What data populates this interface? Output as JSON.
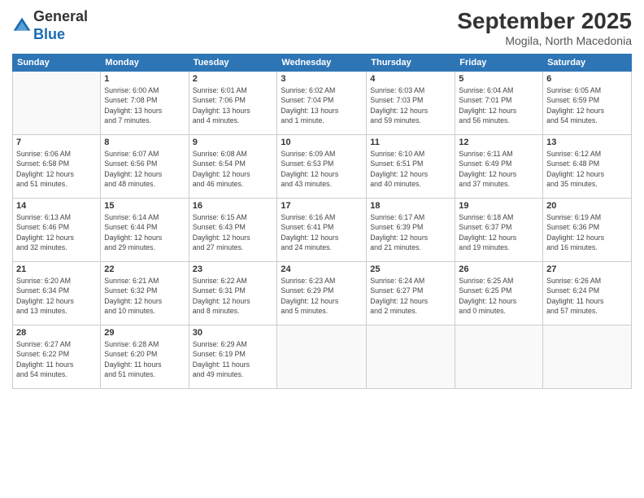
{
  "header": {
    "logo_line1": "General",
    "logo_line2": "Blue",
    "month": "September 2025",
    "location": "Mogila, North Macedonia"
  },
  "weekdays": [
    "Sunday",
    "Monday",
    "Tuesday",
    "Wednesday",
    "Thursday",
    "Friday",
    "Saturday"
  ],
  "weeks": [
    [
      {
        "day": "",
        "info": ""
      },
      {
        "day": "1",
        "info": "Sunrise: 6:00 AM\nSunset: 7:08 PM\nDaylight: 13 hours\nand 7 minutes."
      },
      {
        "day": "2",
        "info": "Sunrise: 6:01 AM\nSunset: 7:06 PM\nDaylight: 13 hours\nand 4 minutes."
      },
      {
        "day": "3",
        "info": "Sunrise: 6:02 AM\nSunset: 7:04 PM\nDaylight: 13 hours\nand 1 minute."
      },
      {
        "day": "4",
        "info": "Sunrise: 6:03 AM\nSunset: 7:03 PM\nDaylight: 12 hours\nand 59 minutes."
      },
      {
        "day": "5",
        "info": "Sunrise: 6:04 AM\nSunset: 7:01 PM\nDaylight: 12 hours\nand 56 minutes."
      },
      {
        "day": "6",
        "info": "Sunrise: 6:05 AM\nSunset: 6:59 PM\nDaylight: 12 hours\nand 54 minutes."
      }
    ],
    [
      {
        "day": "7",
        "info": "Sunrise: 6:06 AM\nSunset: 6:58 PM\nDaylight: 12 hours\nand 51 minutes."
      },
      {
        "day": "8",
        "info": "Sunrise: 6:07 AM\nSunset: 6:56 PM\nDaylight: 12 hours\nand 48 minutes."
      },
      {
        "day": "9",
        "info": "Sunrise: 6:08 AM\nSunset: 6:54 PM\nDaylight: 12 hours\nand 46 minutes."
      },
      {
        "day": "10",
        "info": "Sunrise: 6:09 AM\nSunset: 6:53 PM\nDaylight: 12 hours\nand 43 minutes."
      },
      {
        "day": "11",
        "info": "Sunrise: 6:10 AM\nSunset: 6:51 PM\nDaylight: 12 hours\nand 40 minutes."
      },
      {
        "day": "12",
        "info": "Sunrise: 6:11 AM\nSunset: 6:49 PM\nDaylight: 12 hours\nand 37 minutes."
      },
      {
        "day": "13",
        "info": "Sunrise: 6:12 AM\nSunset: 6:48 PM\nDaylight: 12 hours\nand 35 minutes."
      }
    ],
    [
      {
        "day": "14",
        "info": "Sunrise: 6:13 AM\nSunset: 6:46 PM\nDaylight: 12 hours\nand 32 minutes."
      },
      {
        "day": "15",
        "info": "Sunrise: 6:14 AM\nSunset: 6:44 PM\nDaylight: 12 hours\nand 29 minutes."
      },
      {
        "day": "16",
        "info": "Sunrise: 6:15 AM\nSunset: 6:43 PM\nDaylight: 12 hours\nand 27 minutes."
      },
      {
        "day": "17",
        "info": "Sunrise: 6:16 AM\nSunset: 6:41 PM\nDaylight: 12 hours\nand 24 minutes."
      },
      {
        "day": "18",
        "info": "Sunrise: 6:17 AM\nSunset: 6:39 PM\nDaylight: 12 hours\nand 21 minutes."
      },
      {
        "day": "19",
        "info": "Sunrise: 6:18 AM\nSunset: 6:37 PM\nDaylight: 12 hours\nand 19 minutes."
      },
      {
        "day": "20",
        "info": "Sunrise: 6:19 AM\nSunset: 6:36 PM\nDaylight: 12 hours\nand 16 minutes."
      }
    ],
    [
      {
        "day": "21",
        "info": "Sunrise: 6:20 AM\nSunset: 6:34 PM\nDaylight: 12 hours\nand 13 minutes."
      },
      {
        "day": "22",
        "info": "Sunrise: 6:21 AM\nSunset: 6:32 PM\nDaylight: 12 hours\nand 10 minutes."
      },
      {
        "day": "23",
        "info": "Sunrise: 6:22 AM\nSunset: 6:31 PM\nDaylight: 12 hours\nand 8 minutes."
      },
      {
        "day": "24",
        "info": "Sunrise: 6:23 AM\nSunset: 6:29 PM\nDaylight: 12 hours\nand 5 minutes."
      },
      {
        "day": "25",
        "info": "Sunrise: 6:24 AM\nSunset: 6:27 PM\nDaylight: 12 hours\nand 2 minutes."
      },
      {
        "day": "26",
        "info": "Sunrise: 6:25 AM\nSunset: 6:25 PM\nDaylight: 12 hours\nand 0 minutes."
      },
      {
        "day": "27",
        "info": "Sunrise: 6:26 AM\nSunset: 6:24 PM\nDaylight: 11 hours\nand 57 minutes."
      }
    ],
    [
      {
        "day": "28",
        "info": "Sunrise: 6:27 AM\nSunset: 6:22 PM\nDaylight: 11 hours\nand 54 minutes."
      },
      {
        "day": "29",
        "info": "Sunrise: 6:28 AM\nSunset: 6:20 PM\nDaylight: 11 hours\nand 51 minutes."
      },
      {
        "day": "30",
        "info": "Sunrise: 6:29 AM\nSunset: 6:19 PM\nDaylight: 11 hours\nand 49 minutes."
      },
      {
        "day": "",
        "info": ""
      },
      {
        "day": "",
        "info": ""
      },
      {
        "day": "",
        "info": ""
      },
      {
        "day": "",
        "info": ""
      }
    ]
  ]
}
